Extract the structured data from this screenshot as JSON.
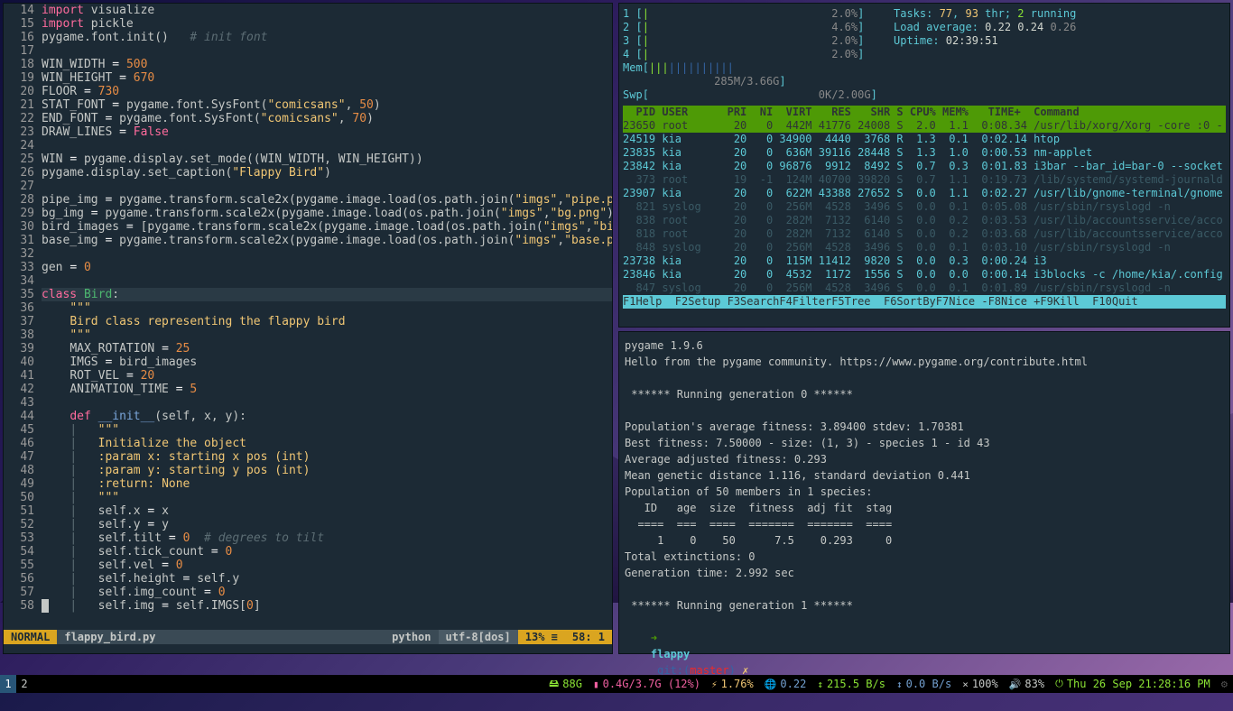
{
  "editor": {
    "lines": [
      {
        "n": 14,
        "html": "<span class='kw'>import</span> <span class='tx'>visualize</span>"
      },
      {
        "n": 15,
        "html": "<span class='kw'>import</span> <span class='tx'>pickle</span>"
      },
      {
        "n": 16,
        "html": "<span class='tx'>pygame.font.init()</span>   <span class='cmt'># init font</span>"
      },
      {
        "n": 17,
        "html": ""
      },
      {
        "n": 18,
        "html": "<span class='tx'>WIN_WIDTH </span><span class='op'>=</span> <span class='num'>500</span>"
      },
      {
        "n": 19,
        "html": "<span class='tx'>WIN_HEIGHT </span><span class='op'>=</span> <span class='num'>670</span>"
      },
      {
        "n": 20,
        "html": "<span class='tx'>FLOOR </span><span class='op'>=</span> <span class='num'>730</span>"
      },
      {
        "n": 21,
        "html": "<span class='tx'>STAT_FONT </span><span class='op'>=</span> <span class='tx'>pygame.font.SysFont(</span><span class='str'>\"comicsans\"</span><span class='tx'>, </span><span class='num'>50</span><span class='tx'>)</span>"
      },
      {
        "n": 22,
        "html": "<span class='tx'>END_FONT </span><span class='op'>=</span> <span class='tx'>pygame.font.SysFont(</span><span class='str'>\"comicsans\"</span><span class='tx'>, </span><span class='num'>70</span><span class='tx'>)</span>"
      },
      {
        "n": 23,
        "html": "<span class='tx'>DRAW_LINES </span><span class='op'>=</span> <span class='kw'>False</span>"
      },
      {
        "n": 24,
        "html": ""
      },
      {
        "n": 25,
        "html": "<span class='tx'>WIN </span><span class='op'>=</span> <span class='tx'>pygame.display.set_mode((WIN_WIDTH, WIN_HEIGHT))</span>"
      },
      {
        "n": 26,
        "html": "<span class='tx'>pygame.display.set_caption(</span><span class='str'>\"Flappy Bird\"</span><span class='tx'>)</span>"
      },
      {
        "n": 27,
        "html": ""
      },
      {
        "n": 28,
        "html": "<span class='tx'>pipe_img </span><span class='op'>=</span> <span class='tx'>pygame.transform.scale2x(pygame.image.load(os.path.join(</span><span class='str'>\"imgs\"</span><span class='tx'>,</span><span class='str'>\"pipe.png\"</span><span class='tx'>)).c</span>"
      },
      {
        "n": 29,
        "html": "<span class='tx'>bg_img </span><span class='op'>=</span> <span class='tx'>pygame.transform.scale2x(pygame.image.load(os.path.join(</span><span class='str'>\"imgs\"</span><span class='tx'>,</span><span class='str'>\"bg.png\"</span><span class='tx'>)).convert</span>"
      },
      {
        "n": 30,
        "html": "<span class='tx'>bird_images </span><span class='op'>=</span> <span class='tx'>[pygame.transform.scale2x(pygame.image.load(os.path.join(</span><span class='str'>\"imgs\"</span><span class='tx'>,</span><span class='str'>\"bird\"</span><span class='tx'> + s</span>"
      },
      {
        "n": 31,
        "html": "<span class='tx'>base_img </span><span class='op'>=</span> <span class='tx'>pygame.transform.scale2x(pygame.image.load(os.path.join(</span><span class='str'>\"imgs\"</span><span class='tx'>,</span><span class='str'>\"base.png\"</span><span class='tx'>)).c</span>"
      },
      {
        "n": 32,
        "html": ""
      },
      {
        "n": 33,
        "html": "<span class='tx'>gen </span><span class='op'>=</span> <span class='num'>0</span>"
      },
      {
        "n": 34,
        "html": ""
      },
      {
        "n": 35,
        "html": "<span class='kw'>class</span> <span class='cls'>Bird</span><span class='tx'>:</span>",
        "hl": true
      },
      {
        "n": 36,
        "html": "    <span class='str'>\"\"\"</span>"
      },
      {
        "n": 37,
        "html": "    <span class='str'>Bird class representing the flappy bird</span>"
      },
      {
        "n": 38,
        "html": "    <span class='str'>\"\"\"</span>"
      },
      {
        "n": 39,
        "html": "    <span class='tx'>MAX_ROTATION </span><span class='op'>=</span> <span class='num'>25</span>"
      },
      {
        "n": 40,
        "html": "    <span class='tx'>IMGS </span><span class='op'>=</span> <span class='tx'>bird_images</span>"
      },
      {
        "n": 41,
        "html": "    <span class='tx'>ROT_VEL </span><span class='op'>=</span> <span class='num'>20</span>"
      },
      {
        "n": 42,
        "html": "    <span class='tx'>ANIMATION_TIME </span><span class='op'>=</span> <span class='num'>5</span>"
      },
      {
        "n": 43,
        "html": ""
      },
      {
        "n": 44,
        "html": "    <span class='kw'>def</span> <span class='fn'>__init__</span><span class='tx'>(self, x, y):</span>"
      },
      {
        "n": 45,
        "html": "    <span class='bar'>|</span>   <span class='str'>\"\"\"</span>"
      },
      {
        "n": 46,
        "html": "    <span class='bar'>|</span>   <span class='str'>Initialize the object</span>"
      },
      {
        "n": 47,
        "html": "    <span class='bar'>|</span>   <span class='str'>:param x: starting x pos (int)</span>"
      },
      {
        "n": 48,
        "html": "    <span class='bar'>|</span>   <span class='str'>:param y: starting y pos (int)</span>"
      },
      {
        "n": 49,
        "html": "    <span class='bar'>|</span>   <span class='str'>:return: None</span>"
      },
      {
        "n": 50,
        "html": "    <span class='bar'>|</span>   <span class='str'>\"\"\"</span>"
      },
      {
        "n": 51,
        "html": "    <span class='bar'>|</span>   <span class='tx'>self.x </span><span class='op'>=</span> <span class='tx'>x</span>"
      },
      {
        "n": 52,
        "html": "    <span class='bar'>|</span>   <span class='tx'>self.y </span><span class='op'>=</span> <span class='tx'>y</span>"
      },
      {
        "n": 53,
        "html": "    <span class='bar'>|</span>   <span class='tx'>self.tilt </span><span class='op'>=</span> <span class='num'>0</span>  <span class='cmt'># degrees to tilt</span>"
      },
      {
        "n": 54,
        "html": "    <span class='bar'>|</span>   <span class='tx'>self.tick_count </span><span class='op'>=</span> <span class='num'>0</span>"
      },
      {
        "n": 55,
        "html": "    <span class='bar'>|</span>   <span class='tx'>self.vel </span><span class='op'>=</span> <span class='num'>0</span>"
      },
      {
        "n": 56,
        "html": "    <span class='bar'>|</span>   <span class='tx'>self.height </span><span class='op'>=</span> <span class='tx'>self.y</span>"
      },
      {
        "n": 57,
        "html": "    <span class='bar'>|</span>   <span class='tx'>self.img_count </span><span class='op'>=</span> <span class='num'>0</span>"
      },
      {
        "n": 58,
        "html": "<span class='cursor'> </span>   <span class='bar'>|</span>   <span class='tx'>self.img </span><span class='op'>=</span> <span class='tx'>self.IMGS[</span><span class='num'>0</span><span class='tx'>]</span>"
      }
    ],
    "status": {
      "mode": "NORMAL",
      "file": "flappy_bird.py",
      "type": "python",
      "enc": "utf-8[dos]",
      "pct": "13% ≡",
      "pos": "58:  1"
    }
  },
  "htop": {
    "cpus": [
      {
        "n": "1",
        "pct": "2.0%"
      },
      {
        "n": "2",
        "pct": "4.6%"
      },
      {
        "n": "3",
        "pct": "2.0%"
      },
      {
        "n": "4",
        "pct": "2.0%"
      }
    ],
    "mem": "285M/3.66G",
    "swp": "0K/2.00G",
    "tasks": "Tasks: ",
    "tasks_n": "77",
    "tasks_sep": ", ",
    "thr": "93",
    "thr_t": " thr; ",
    "run": "2",
    "run_t": " running",
    "load": "Load average: ",
    "l1": "0.22",
    "l2": "0.24",
    "l3": "0.26",
    "uptime": "Uptime: ",
    "ut": "02:39:51",
    "cols": "  PID USER      PRI  NI  VIRT   RES   SHR S CPU% MEM%   TIME+  Command",
    "rows": [
      {
        "hl": true,
        "t": "23650 root       20   0  442M 41776 24008 S  2.0  1.1  0:08.34 /usr/lib/xorg/Xorg -core :0 -"
      },
      {
        "t": "24519 kia        20   0 34900  4440  3768 R  1.3  0.1  0:02.14 htop"
      },
      {
        "t": "23835 kia        20   0  636M 39116 28448 S  1.3  1.0  0:00.53 nm-applet"
      },
      {
        "t": "23842 kia        20   0 96876  9912  8492 S  0.7  0.3  0:01.83 i3bar --bar_id=bar-0 --socket"
      },
      {
        "t": "  373 root       19  -1  124M 40700 39820 S  0.7  1.1  0:19.73 /lib/systemd/systemd-journald",
        "dim": true
      },
      {
        "t": "23907 kia        20   0  622M 43388 27652 S  0.0  1.1  0:02.27 /usr/lib/gnome-terminal/gnome"
      },
      {
        "t": "  821 syslog     20   0  256M  4528  3496 S  0.0  0.1  0:05.08 /usr/sbin/rsyslogd -n",
        "dim": true
      },
      {
        "t": "  838 root       20   0  282M  7132  6140 S  0.0  0.2  0:03.53 /usr/lib/accountsservice/acco",
        "dim": true
      },
      {
        "t": "  818 root       20   0  282M  7132  6140 S  0.0  0.2  0:03.68 /usr/lib/accountsservice/acco",
        "dim": true
      },
      {
        "t": "  848 syslog     20   0  256M  4528  3496 S  0.0  0.1  0:03.10 /usr/sbin/rsyslogd -n",
        "dim": true
      },
      {
        "t": "23738 kia        20   0  115M 11412  9820 S  0.0  0.3  0:00.24 i3"
      },
      {
        "t": "23846 kia        20   0  4532  1172  1556 S  0.0  0.0  0:00.14 i3blocks -c /home/kia/.config"
      },
      {
        "t": "  847 syslog     20   0  256M  4528  3496 S  0.0  0.1  0:01.89 /usr/sbin/rsyslogd -n",
        "dim": true
      }
    ],
    "fn": "F1Help  F2Setup F3SearchF4FilterF5Tree  F6SortByF7Nice -F8Nice +F9Kill  F10Quit"
  },
  "term": {
    "lines": [
      "pygame 1.9.6",
      "Hello from the pygame community. https://www.pygame.org/contribute.html",
      "",
      " ****** Running generation 0 ****** ",
      "",
      "Population's average fitness: 3.89400 stdev: 1.70381",
      "Best fitness: 7.50000 - size: (1, 3) - species 1 - id 43",
      "Average adjusted fitness: 0.293",
      "Mean genetic distance 1.116, standard deviation 0.441",
      "Population of 50 members in 1 species:",
      "   ID   age  size  fitness  adj fit  stag",
      "  ====  ===  ====  =======  =======  ====",
      "     1    0    50      7.5    0.293     0",
      "Total extinctions: 0",
      "Generation time: 2.992 sec",
      "",
      " ****** Running generation 1 ****** "
    ],
    "prompt": {
      "arrow": "➜ ",
      "dir": "flappy",
      "git": " git:(",
      "branch": "master",
      "gitend": ") ",
      "dirty": "✗"
    }
  },
  "i3bar": {
    "ws": [
      "1",
      "2"
    ],
    "active": 0,
    "items": [
      {
        "ico": "🖴",
        "t": "88G",
        "c": "#8ae234"
      },
      {
        "ico": "▮",
        "t": "0.4G/3.7G (12%)",
        "c": "#ef5fa0"
      },
      {
        "ico": "⚡",
        "t": "1.76%",
        "c": "#f0c674"
      },
      {
        "ico": "🌐",
        "t": "0.22",
        "c": "#729fcf"
      },
      {
        "ico": "↕",
        "t": "215.5  B/s",
        "c": "#8ae234"
      },
      {
        "ico": "↕",
        "t": "0.0  B/s",
        "c": "#729fcf"
      },
      {
        "ico": "×",
        "t": "100%",
        "c": "#c5c8c6"
      },
      {
        "ico": "🔊",
        "t": "83%",
        "c": "#c5c8c6"
      },
      {
        "ico": "⏻",
        "t": "Thu 26 Sep 21:28:16 PM",
        "c": "#8ae234"
      }
    ]
  }
}
